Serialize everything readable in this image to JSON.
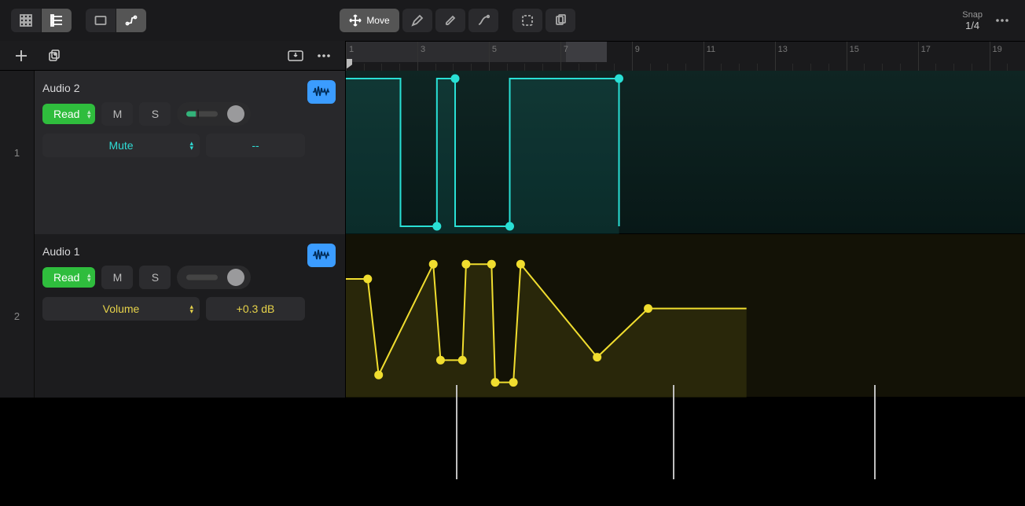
{
  "toolbar": {
    "move_label": "Move"
  },
  "snap": {
    "label": "Snap",
    "value": "1/4"
  },
  "ruler": {
    "labels": [
      "1",
      "3",
      "5",
      "7",
      "9",
      "11",
      "13",
      "15",
      "17",
      "19"
    ]
  },
  "tracks": [
    {
      "index": "1",
      "name": "Audio 2",
      "mode": "Read",
      "mute": "M",
      "solo": "S",
      "param": "Mute",
      "value": "--",
      "color": "teal"
    },
    {
      "index": "2",
      "name": "Audio 1",
      "mode": "Read",
      "mute": "M",
      "solo": "S",
      "param": "Volume",
      "value": "+0.3 dB",
      "color": "yellow"
    }
  ],
  "chart_data": [
    {
      "type": "line",
      "lane": 1,
      "param": "Mute",
      "color": "#29e0d5",
      "x_unit": "bars",
      "y_unit": "mute state (0=off,1=on)",
      "points": [
        {
          "x": 1.0,
          "y": 1
        },
        {
          "x": 2.5,
          "y": 1
        },
        {
          "x": 2.5,
          "y": 0
        },
        {
          "x": 3.5,
          "y": 0
        },
        {
          "x": 3.5,
          "y": 1
        },
        {
          "x": 4.0,
          "y": 1
        },
        {
          "x": 4.0,
          "y": 0
        },
        {
          "x": 5.5,
          "y": 0
        },
        {
          "x": 5.5,
          "y": 1
        },
        {
          "x": 8.5,
          "y": 1
        },
        {
          "x": 8.5,
          "y": 0
        }
      ],
      "node_x": [
        3.5,
        4.0,
        5.5,
        8.5
      ]
    },
    {
      "type": "line",
      "lane": 2,
      "param": "Volume",
      "color": "#f0dd2f",
      "x_unit": "bars",
      "y_unit": "normalized 0..1",
      "points": [
        {
          "x": 1.0,
          "y": 0.75
        },
        {
          "x": 1.6,
          "y": 0.75
        },
        {
          "x": 1.9,
          "y": 0.1
        },
        {
          "x": 3.4,
          "y": 0.85
        },
        {
          "x": 3.6,
          "y": 0.2
        },
        {
          "x": 4.2,
          "y": 0.2
        },
        {
          "x": 4.3,
          "y": 0.85
        },
        {
          "x": 5.0,
          "y": 0.85
        },
        {
          "x": 5.1,
          "y": 0.05
        },
        {
          "x": 5.6,
          "y": 0.05
        },
        {
          "x": 5.8,
          "y": 0.85
        },
        {
          "x": 7.9,
          "y": 0.22
        },
        {
          "x": 9.3,
          "y": 0.55
        },
        {
          "x": 12.0,
          "y": 0.55
        }
      ],
      "node_x": [
        1.6,
        1.9,
        3.4,
        3.6,
        4.2,
        4.3,
        5.0,
        5.1,
        5.6,
        5.8,
        7.9,
        9.3
      ]
    }
  ]
}
